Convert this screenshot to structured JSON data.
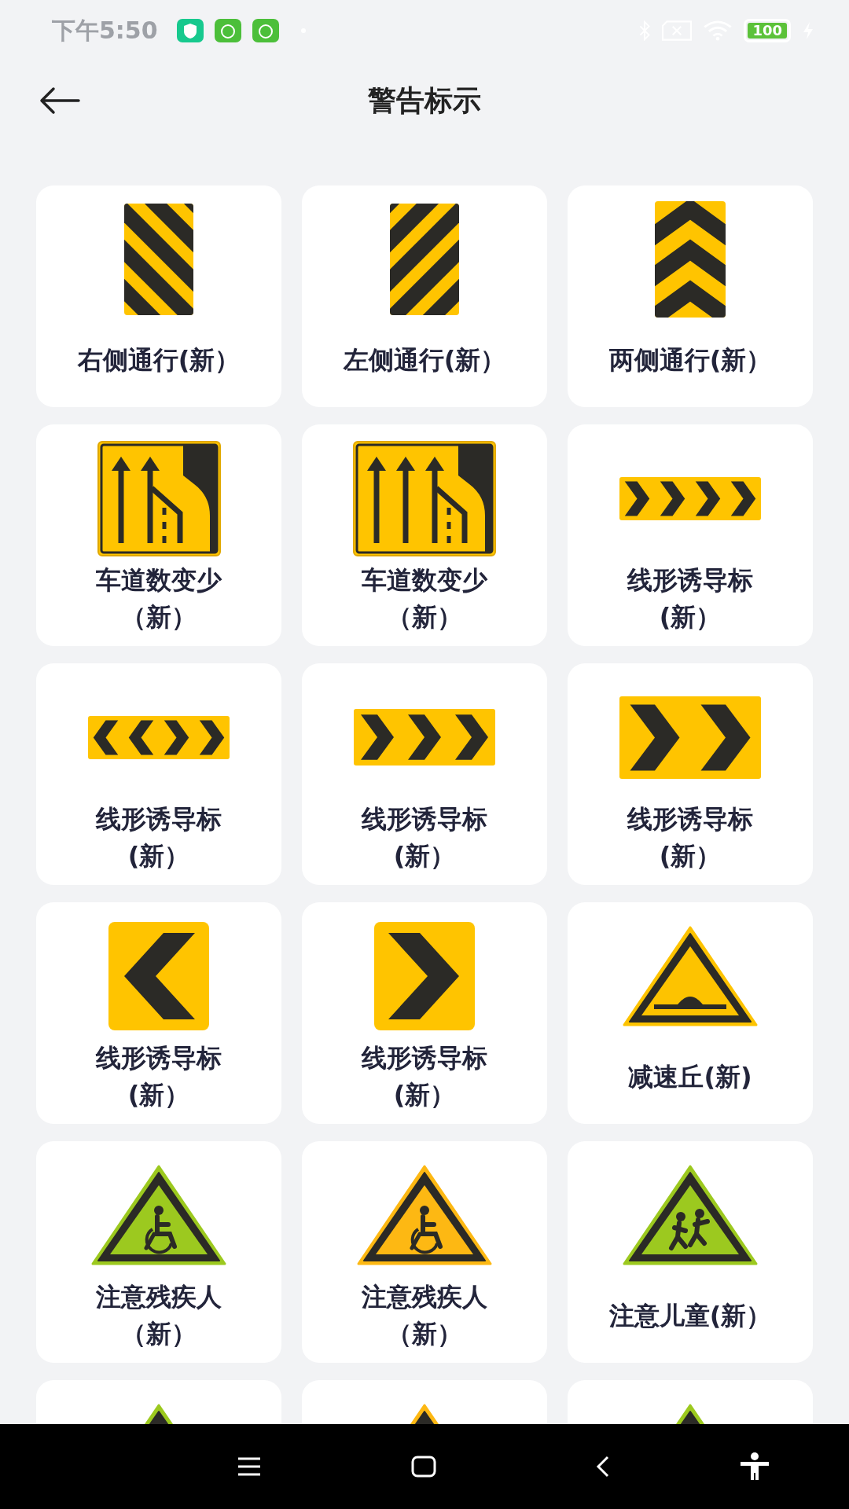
{
  "status_bar": {
    "time": "下午5:50",
    "battery": "100"
  },
  "header": {
    "title": "警告标示"
  },
  "items": [
    {
      "kind": "stripes-right",
      "lines": [
        "右侧通行(新）"
      ]
    },
    {
      "kind": "stripes-left",
      "lines": [
        "左侧通行(新）"
      ]
    },
    {
      "kind": "chevron-up",
      "lines": [
        "两侧通行(新）"
      ]
    },
    {
      "kind": "lane-reduce-2",
      "lines": [
        "车道数变少",
        "（新）"
      ]
    },
    {
      "kind": "lane-reduce-3",
      "lines": [
        "车道数变少",
        "（新）"
      ]
    },
    {
      "kind": "strip-4",
      "lines": [
        "线形诱导标",
        "(新）"
      ]
    },
    {
      "kind": "strip-both",
      "lines": [
        "线形诱导标",
        "(新）"
      ]
    },
    {
      "kind": "strip-3",
      "lines": [
        "线形诱导标",
        "(新）"
      ]
    },
    {
      "kind": "strip-2",
      "lines": [
        "线形诱导标",
        "(新）"
      ]
    },
    {
      "kind": "square-left",
      "lines": [
        "线形诱导标",
        "(新）"
      ]
    },
    {
      "kind": "square-right",
      "lines": [
        "线形诱导标",
        "(新）"
      ]
    },
    {
      "kind": "speed-bump",
      "color": "#fdc300",
      "lines": [
        "减速丘(新)"
      ]
    },
    {
      "kind": "wheelchair",
      "color": "#9cc91f",
      "lines": [
        "注意残疾人",
        "（新）"
      ]
    },
    {
      "kind": "wheelchair",
      "color": "#fdb813",
      "lines": [
        "注意残疾人",
        "（新）"
      ]
    },
    {
      "kind": "children",
      "color": "#9cc91f",
      "lines": [
        "注意儿童(新）"
      ]
    },
    {
      "kind": "triangle",
      "color": "#9cc91f"
    },
    {
      "kind": "triangle",
      "color": "#fdb813"
    },
    {
      "kind": "triangle",
      "color": "#9cc91f"
    }
  ]
}
